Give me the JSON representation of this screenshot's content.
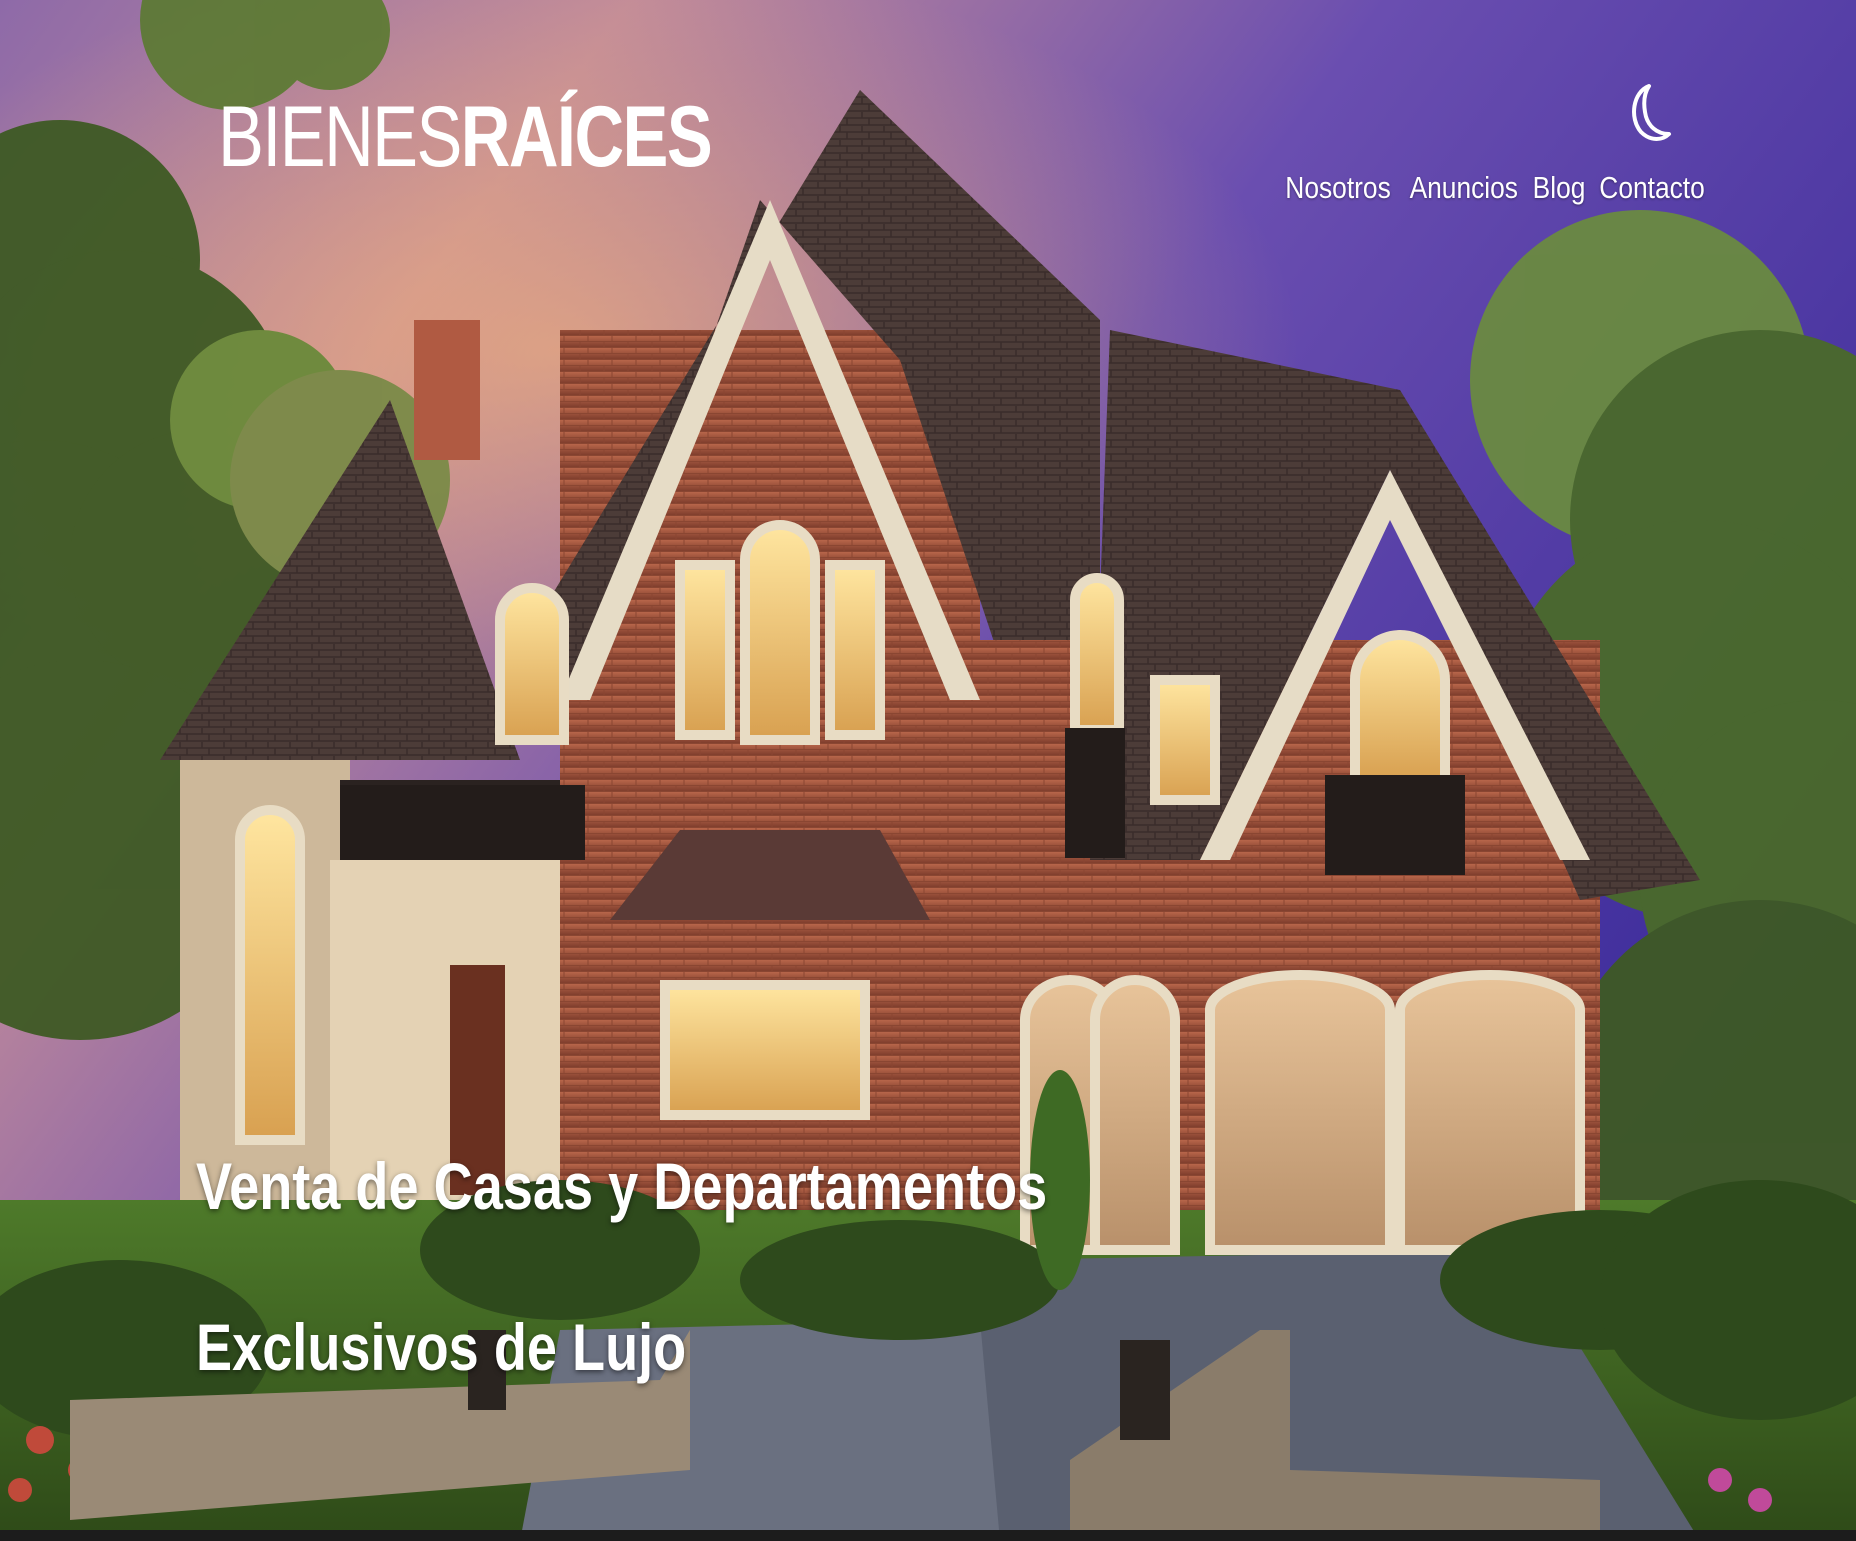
{
  "header": {
    "logo": {
      "light": "BIENES",
      "bold": "RAÍCES"
    },
    "dark_mode_icon": "crescent-moon-icon",
    "nav": [
      {
        "label": "Nosotros"
      },
      {
        "label": "Anuncios"
      },
      {
        "label": "Blog"
      },
      {
        "label": "Contacto"
      }
    ]
  },
  "hero": {
    "heading_line1": "Venta de Casas y Departamentos",
    "heading_line2": "Exclusivos de Lujo",
    "image": "luxury-brick-house-at-dusk"
  },
  "colors": {
    "sky_top": "#6a4a9e",
    "text": "#ffffff",
    "brick": "#a0523a",
    "roof": "#4a3a36"
  }
}
